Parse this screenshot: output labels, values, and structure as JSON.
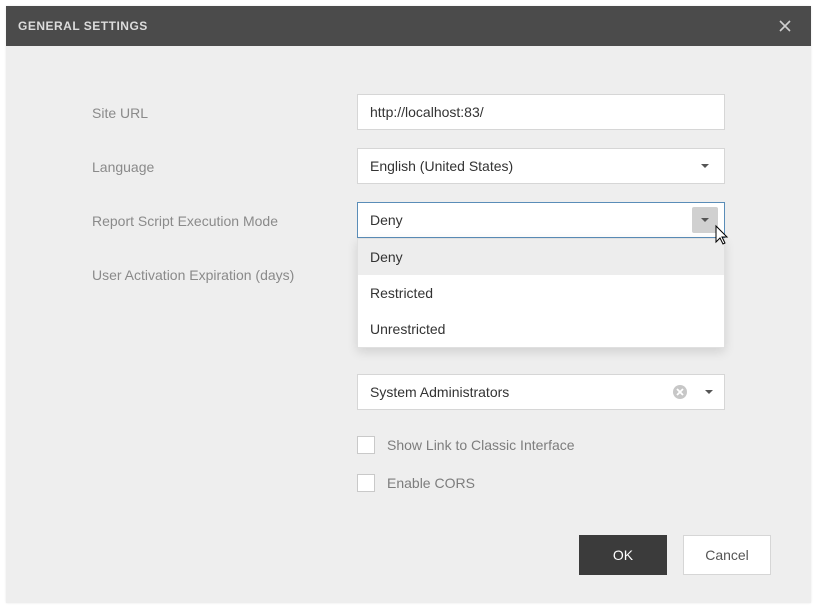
{
  "dialog": {
    "title": "GENERAL SETTINGS"
  },
  "form": {
    "siteUrl": {
      "label": "Site URL",
      "value": "http://localhost:83/"
    },
    "language": {
      "label": "Language",
      "value": "English (United States)"
    },
    "scriptMode": {
      "label": "Report Script Execution Mode",
      "value": "Deny",
      "options": [
        "Deny",
        "Restricted",
        "Unrestricted"
      ]
    },
    "userActivation": {
      "label": "User Activation Expiration (days)"
    },
    "sysAdmins": {
      "value": "System Administrators"
    },
    "showClassic": {
      "label": "Show Link to Classic Interface",
      "checked": false
    },
    "enableCors": {
      "label": "Enable CORS",
      "checked": false
    }
  },
  "actions": {
    "ok": "OK",
    "cancel": "Cancel"
  }
}
